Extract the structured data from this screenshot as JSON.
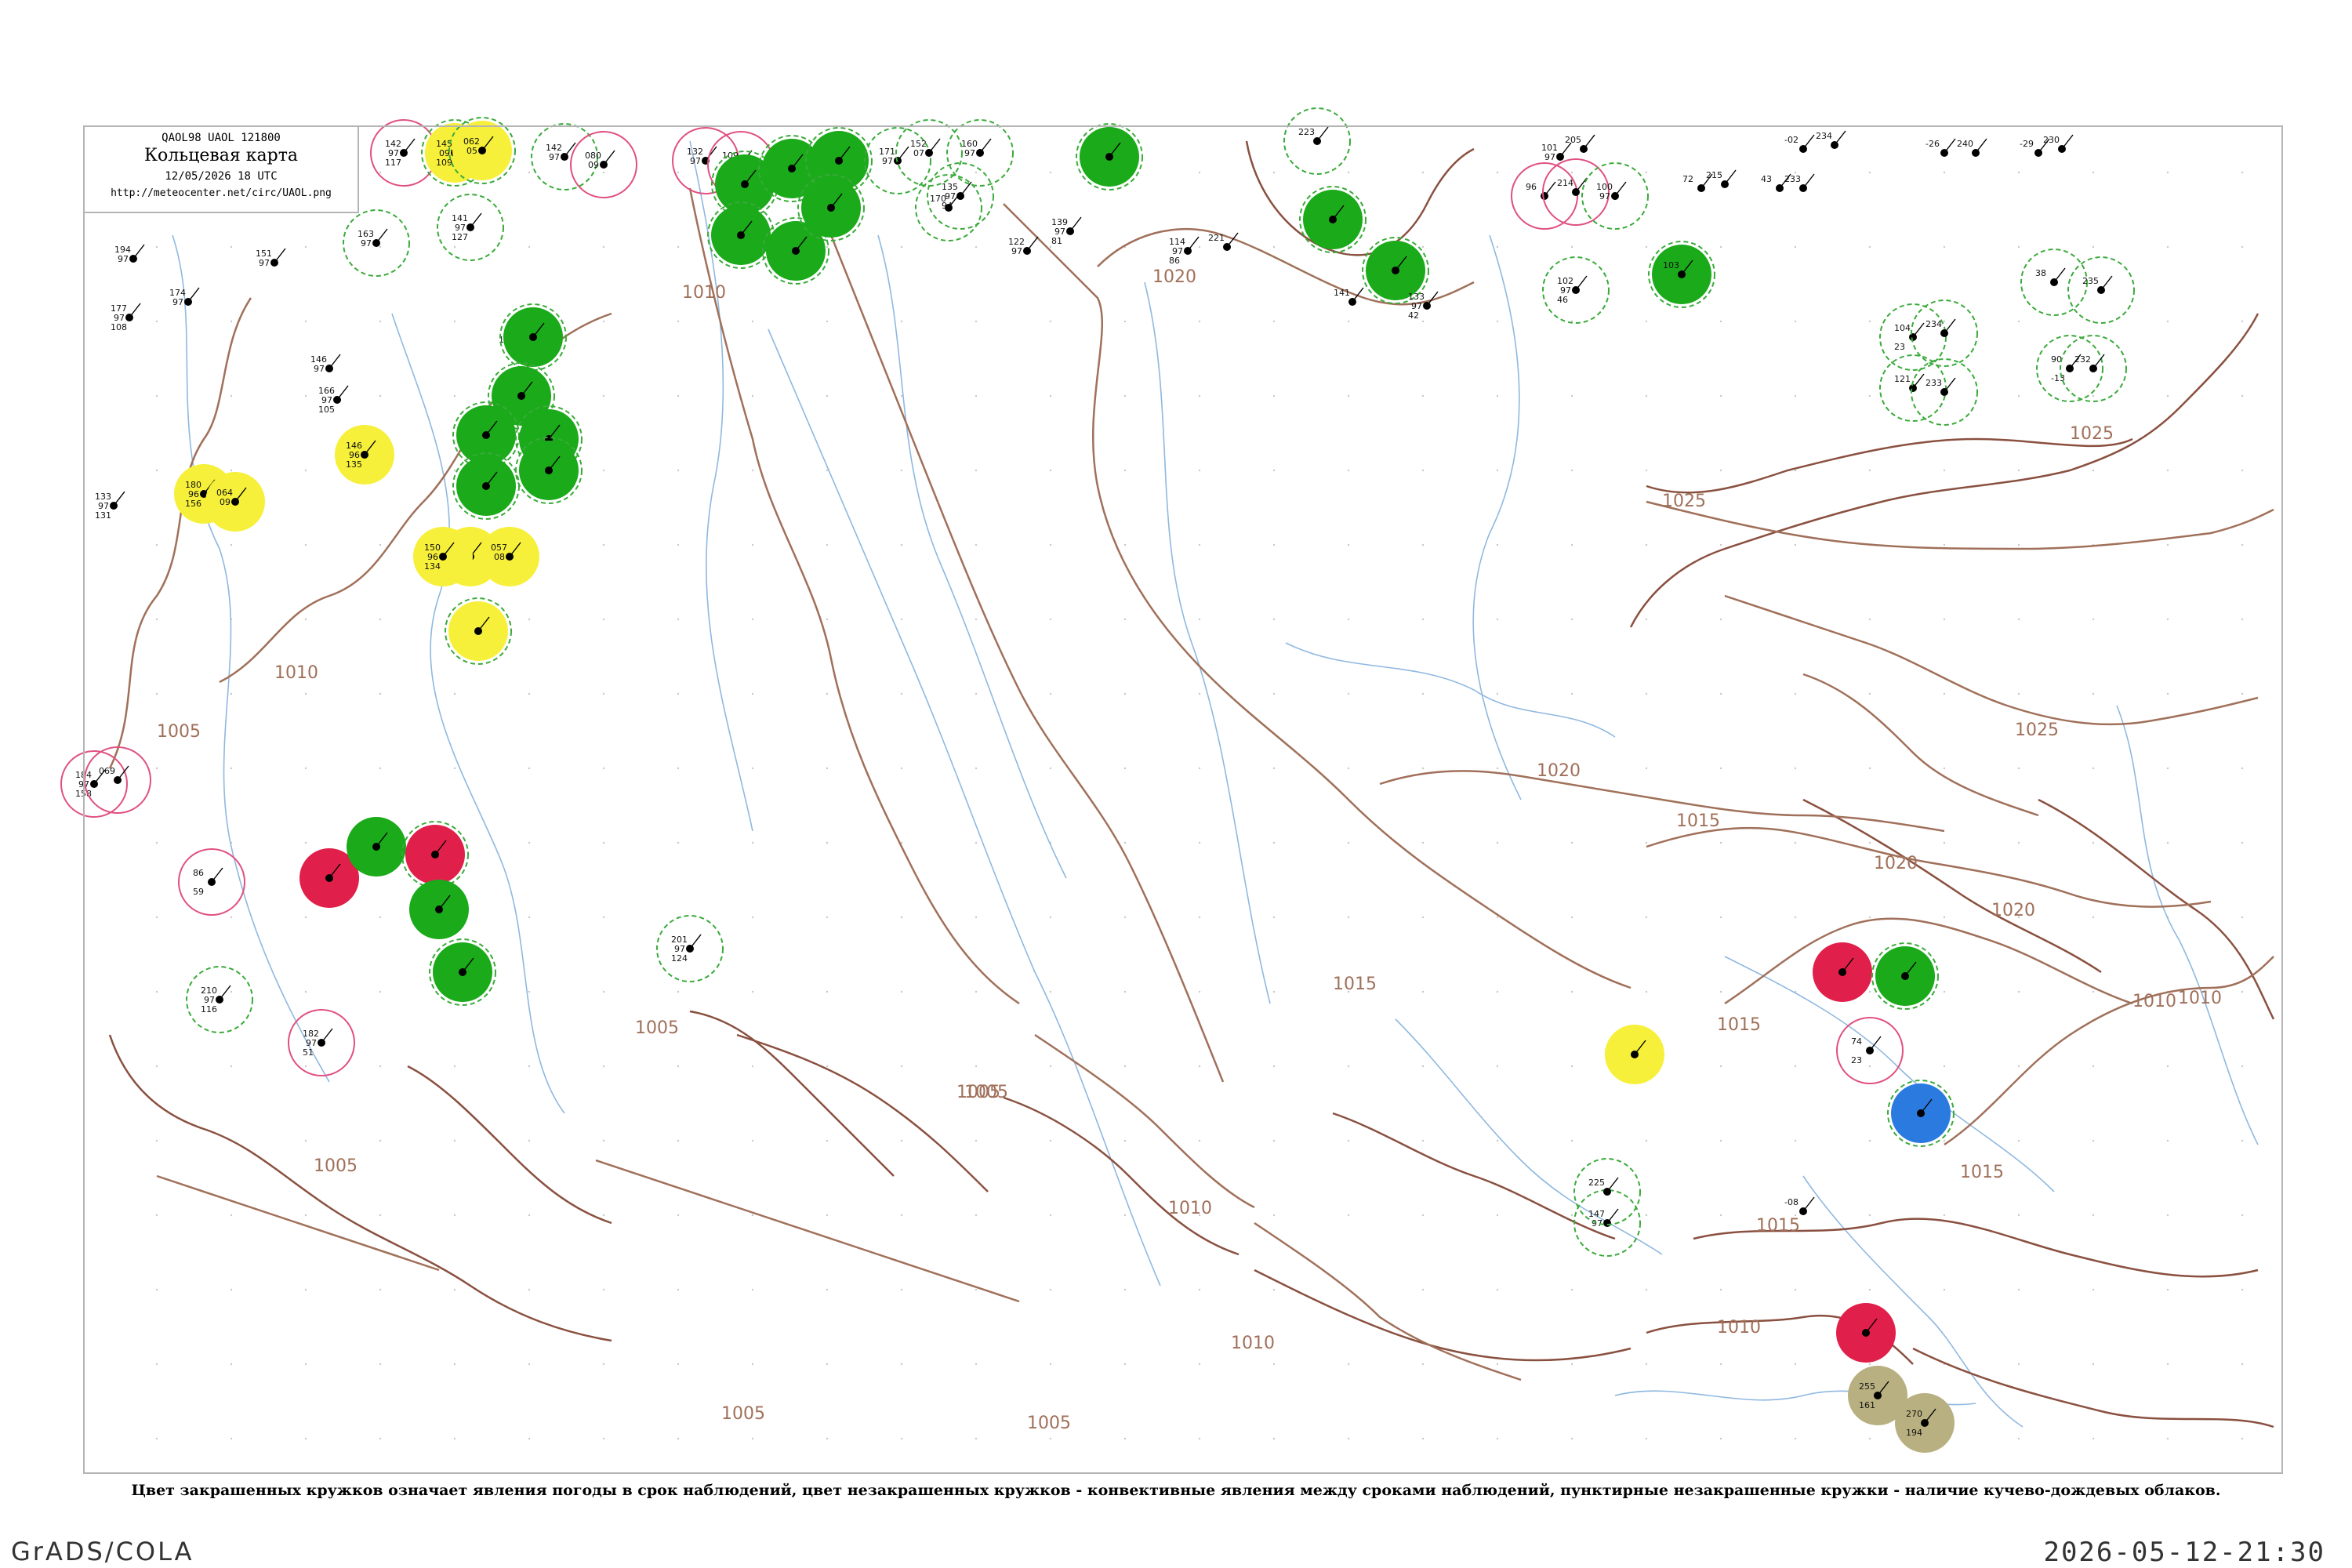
{
  "header": {
    "codes": "QAOL98  UAOL  121800",
    "title": "Кольцевая карта",
    "time": "12/05/2026 18 UTC",
    "url": "http://meteocenter.net/circ/UAOL.png"
  },
  "caption": "Цвет закрашенных кружков означает явления погоды в срок наблюдений, цвет незакрашенных кружков - конвективные явления между сроками наблюдений, пунктирные незакрашенные кружки - наличие кучево-дождевых облаков.",
  "footer": {
    "left": "GrADS/COLA",
    "right": "2026-05-12-21:30"
  },
  "colors": {
    "isobar": "#a0705a",
    "coast": "#8a5040",
    "river": "#8fb8e0",
    "rain": "#1aaa1a",
    "thunder": "#e0204a",
    "fog": "#f6f03a",
    "snow": "#2a7ae0",
    "dust": "#b8b080",
    "cb_dashed": "#3aaa3a",
    "convective": "#e05080"
  },
  "isobar_labels": [
    {
      "text": "1005"
    },
    {
      "text": "1010"
    },
    {
      "text": "1020"
    },
    {
      "text": "1025"
    },
    {
      "text": "1010"
    },
    {
      "text": "1005"
    },
    {
      "text": "1005"
    },
    {
      "text": "1005"
    },
    {
      "text": "1010"
    },
    {
      "text": "1005"
    },
    {
      "text": "1010"
    },
    {
      "text": "1015"
    },
    {
      "text": "1020"
    },
    {
      "text": "1015"
    },
    {
      "text": "1020"
    },
    {
      "text": "1025"
    },
    {
      "text": "1025"
    },
    {
      "text": "1020"
    },
    {
      "text": "1010"
    },
    {
      "text": "1015"
    },
    {
      "text": "1015"
    },
    {
      "text": "1010"
    },
    {
      "text": "1005"
    },
    {
      "text": "1005"
    },
    {
      "text": "1015"
    },
    {
      "text": "1010"
    }
  ],
  "stations": [
    {
      "p": "142",
      "t": "97",
      "d": "117",
      "fill": "none",
      "ring": "convective"
    },
    {
      "p": "145",
      "t": "097",
      "d": "109",
      "fill": "fog",
      "ring": "cb_dashed"
    },
    {
      "p": "062",
      "t": "05",
      "d": "",
      "fill": "fog",
      "ring": "cb_dashed"
    },
    {
      "p": "163",
      "t": "97",
      "d": "",
      "fill": "none",
      "ring": "cb_dashed"
    },
    {
      "p": "194",
      "t": "97",
      "d": "",
      "fill": "none",
      "ring": "none"
    },
    {
      "p": "177",
      "t": "97",
      "d": "108",
      "fill": "none",
      "ring": "none"
    },
    {
      "p": "174",
      "t": "97",
      "d": "",
      "fill": "none",
      "ring": "none"
    },
    {
      "p": "151",
      "t": "97",
      "d": "",
      "fill": "none",
      "ring": "none"
    },
    {
      "p": "141",
      "t": "97",
      "d": "127",
      "fill": "none",
      "ring": "cb_dashed"
    },
    {
      "p": "142",
      "t": "97",
      "d": "",
      "fill": "none",
      "ring": "cb_dashed"
    },
    {
      "p": "080",
      "t": "09",
      "d": "",
      "fill": "none",
      "ring": "convective"
    },
    {
      "p": "132",
      "t": "97",
      "d": "",
      "fill": "none",
      "ring": "convective"
    },
    {
      "p": "109",
      "t": "",
      "d": "",
      "fill": "none",
      "ring": "convective"
    },
    {
      "p": "",
      "t": "",
      "d": "",
      "fill": "rain",
      "ring": "cb_dashed"
    },
    {
      "p": "",
      "t": "",
      "d": "",
      "fill": "rain",
      "ring": "cb_dashed"
    },
    {
      "p": "",
      "t": "",
      "d": "",
      "fill": "rain",
      "ring": "cb_dashed"
    },
    {
      "p": "",
      "t": "",
      "d": "",
      "fill": "rain",
      "ring": "cb_dashed"
    },
    {
      "p": "",
      "t": "",
      "d": "",
      "fill": "rain",
      "ring": "cb_dashed"
    },
    {
      "p": "",
      "t": "",
      "d": "",
      "fill": "rain",
      "ring": "cb_dashed"
    },
    {
      "p": "171",
      "t": "97",
      "d": "",
      "fill": "none",
      "ring": "cb_dashed"
    },
    {
      "p": "152",
      "t": "07",
      "d": "",
      "fill": "none",
      "ring": "cb_dashed"
    },
    {
      "p": "160",
      "t": "97",
      "d": "",
      "fill": "none",
      "ring": "cb_dashed"
    },
    {
      "p": "135",
      "t": "97",
      "d": "94",
      "fill": "none",
      "ring": "cb_dashed"
    },
    {
      "p": "170",
      "t": "",
      "d": "",
      "fill": "none",
      "ring": "cb_dashed"
    },
    {
      "p": "",
      "t": "",
      "d": "",
      "fill": "rain",
      "ring": "cb_dashed"
    },
    {
      "p": "139",
      "t": "97",
      "d": "81",
      "fill": "none",
      "ring": "none"
    },
    {
      "p": "122",
      "t": "97",
      "d": "",
      "fill": "none",
      "ring": "none"
    },
    {
      "p": "114",
      "t": "97",
      "d": "86",
      "fill": "none",
      "ring": "none"
    },
    {
      "p": "221",
      "t": "",
      "d": "",
      "fill": "none",
      "ring": "none"
    },
    {
      "p": "223",
      "t": "",
      "d": "",
      "fill": "none",
      "ring": "cb_dashed"
    },
    {
      "p": "",
      "t": "",
      "d": "",
      "fill": "rain",
      "ring": "cb_dashed"
    },
    {
      "p": "",
      "t": "",
      "d": "",
      "fill": "rain",
      "ring": "cb_dashed"
    },
    {
      "p": "141",
      "t": "",
      "d": "",
      "fill": "none",
      "ring": "none"
    },
    {
      "p": "133",
      "t": "97",
      "d": "42",
      "fill": "none",
      "ring": "none"
    },
    {
      "p": "101",
      "t": "97",
      "d": "",
      "fill": "none",
      "ring": "none"
    },
    {
      "p": "205",
      "t": "",
      "d": "",
      "fill": "none",
      "ring": "none"
    },
    {
      "p": "96",
      "t": "",
      "d": "",
      "fill": "none",
      "ring": "convective"
    },
    {
      "p": "214",
      "t": "",
      "d": "",
      "fill": "none",
      "ring": "convective"
    },
    {
      "p": "100",
      "t": "97",
      "d": "",
      "fill": "none",
      "ring": "cb_dashed"
    },
    {
      "p": "102",
      "t": "97",
      "d": "46",
      "fill": "none",
      "ring": "cb_dashed"
    },
    {
      "p": "103",
      "t": "",
      "d": "",
      "fill": "rain",
      "ring": "cb_dashed"
    },
    {
      "p": "72",
      "t": "",
      "d": "",
      "fill": "none",
      "ring": "none"
    },
    {
      "p": "215",
      "t": "",
      "d": "",
      "fill": "none",
      "ring": "none"
    },
    {
      "p": "43",
      "t": "",
      "d": "",
      "fill": "none",
      "ring": "none"
    },
    {
      "p": "233",
      "t": "",
      "d": "",
      "fill": "none",
      "ring": "none"
    },
    {
      "p": "-02",
      "t": "",
      "d": "",
      "fill": "none",
      "ring": "none"
    },
    {
      "p": "234",
      "t": "",
      "d": "",
      "fill": "none",
      "ring": "none"
    },
    {
      "p": "-26",
      "t": "",
      "d": "",
      "fill": "none",
      "ring": "none"
    },
    {
      "p": "240",
      "t": "",
      "d": "",
      "fill": "none",
      "ring": "none"
    },
    {
      "p": "-29",
      "t": "",
      "d": "",
      "fill": "none",
      "ring": "none"
    },
    {
      "p": "230",
      "t": "",
      "d": "",
      "fill": "none",
      "ring": "none"
    },
    {
      "p": "38",
      "t": "",
      "d": "",
      "fill": "none",
      "ring": "cb_dashed"
    },
    {
      "p": "235",
      "t": "",
      "d": "",
      "fill": "none",
      "ring": "cb_dashed"
    },
    {
      "p": "104",
      "t": "",
      "d": "23",
      "fill": "none",
      "ring": "cb_dashed"
    },
    {
      "p": "234",
      "t": "",
      "d": "",
      "fill": "none",
      "ring": "cb_dashed"
    },
    {
      "p": "121",
      "t": "",
      "d": "",
      "fill": "none",
      "ring": "cb_dashed"
    },
    {
      "p": "233",
      "t": "",
      "d": "",
      "fill": "none",
      "ring": "cb_dashed"
    },
    {
      "p": "90",
      "t": "",
      "d": "-13",
      "fill": "none",
      "ring": "cb_dashed"
    },
    {
      "p": "232",
      "t": "",
      "d": "",
      "fill": "none",
      "ring": "cb_dashed"
    },
    {
      "p": "146",
      "t": "97",
      "d": "",
      "fill": "none",
      "ring": "none"
    },
    {
      "p": "166",
      "t": "97",
      "d": "105",
      "fill": "none",
      "ring": "none"
    },
    {
      "p": "146",
      "t": "96",
      "d": "135",
      "fill": "fog",
      "ring": "none"
    },
    {
      "p": "180",
      "t": "96",
      "d": "156",
      "fill": "fog",
      "ring": "none"
    },
    {
      "p": "064",
      "t": "09",
      "d": "",
      "fill": "fog",
      "ring": "none"
    },
    {
      "p": "133",
      "t": "97",
      "d": "131",
      "fill": "none",
      "ring": "none"
    },
    {
      "p": "165",
      "t": "",
      "d": "",
      "fill": "none",
      "ring": "none"
    },
    {
      "p": "",
      "t": "",
      "d": "",
      "fill": "rain",
      "ring": "cb_dashed"
    },
    {
      "p": "",
      "t": "",
      "d": "",
      "fill": "rain",
      "ring": "cb_dashed"
    },
    {
      "p": "",
      "t": "",
      "d": "",
      "fill": "rain",
      "ring": "cb_dashed"
    },
    {
      "p": "",
      "t": "",
      "d": "",
      "fill": "rain",
      "ring": "cb_dashed"
    },
    {
      "p": "",
      "t": "",
      "d": "",
      "fill": "rain",
      "ring": "cb_dashed"
    },
    {
      "p": "",
      "t": "",
      "d": "",
      "fill": "rain",
      "ring": "cb_dashed"
    },
    {
      "p": "151",
      "t": "96",
      "d": "",
      "fill": "fog",
      "ring": "none"
    },
    {
      "p": "057",
      "t": "08",
      "d": "",
      "fill": "fog",
      "ring": "none"
    },
    {
      "p": "150",
      "t": "96",
      "d": "134",
      "fill": "fog",
      "ring": "none"
    },
    {
      "p": "",
      "t": "",
      "d": "",
      "fill": "fog",
      "ring": "cb_dashed"
    },
    {
      "p": "184",
      "t": "97",
      "d": "158",
      "fill": "none",
      "ring": "convective"
    },
    {
      "p": "069",
      "t": "",
      "d": "",
      "fill": "none",
      "ring": "convective"
    },
    {
      "p": "",
      "t": "",
      "d": "",
      "fill": "thunder",
      "ring": "none"
    },
    {
      "p": "",
      "t": "",
      "d": "",
      "fill": "rain",
      "ring": "none"
    },
    {
      "p": "",
      "t": "",
      "d": "",
      "fill": "thunder",
      "ring": "cb_dashed"
    },
    {
      "p": "",
      "t": "",
      "d": "",
      "fill": "rain",
      "ring": "none"
    },
    {
      "p": "",
      "t": "",
      "d": "",
      "fill": "rain",
      "ring": "cb_dashed"
    },
    {
      "p": "86",
      "t": "",
      "d": "59",
      "fill": "none",
      "ring": "convective"
    },
    {
      "p": "210",
      "t": "97",
      "d": "116",
      "fill": "none",
      "ring": "cb_dashed"
    },
    {
      "p": "182",
      "t": "97",
      "d": "51",
      "fill": "none",
      "ring": "convective"
    },
    {
      "p": "201",
      "t": "97",
      "d": "124",
      "fill": "none",
      "ring": "cb_dashed"
    },
    {
      "p": "",
      "t": "",
      "d": "",
      "fill": "thunder",
      "ring": "none"
    },
    {
      "p": "",
      "t": "",
      "d": "",
      "fill": "rain",
      "ring": "cb_dashed"
    },
    {
      "p": "",
      "t": "",
      "d": "",
      "fill": "fog",
      "ring": "none"
    },
    {
      "p": "",
      "t": "",
      "d": "",
      "fill": "snow",
      "ring": "cb_dashed"
    },
    {
      "p": "",
      "t": "",
      "d": "",
      "fill": "thunder",
      "ring": "none"
    },
    {
      "p": "255",
      "t": "",
      "d": "161",
      "fill": "dust",
      "ring": "none"
    },
    {
      "p": "270",
      "t": "",
      "d": "194",
      "fill": "dust",
      "ring": "none"
    },
    {
      "p": "147",
      "t": "97",
      "d": "",
      "fill": "none",
      "ring": "cb_dashed"
    },
    {
      "p": "225",
      "t": "",
      "d": "",
      "fill": "none",
      "ring": "cb_dashed"
    },
    {
      "p": "74",
      "t": "",
      "d": "23",
      "fill": "none",
      "ring": "convective"
    },
    {
      "p": "-08",
      "t": "",
      "d": "",
      "fill": "none",
      "ring": "none"
    }
  ]
}
